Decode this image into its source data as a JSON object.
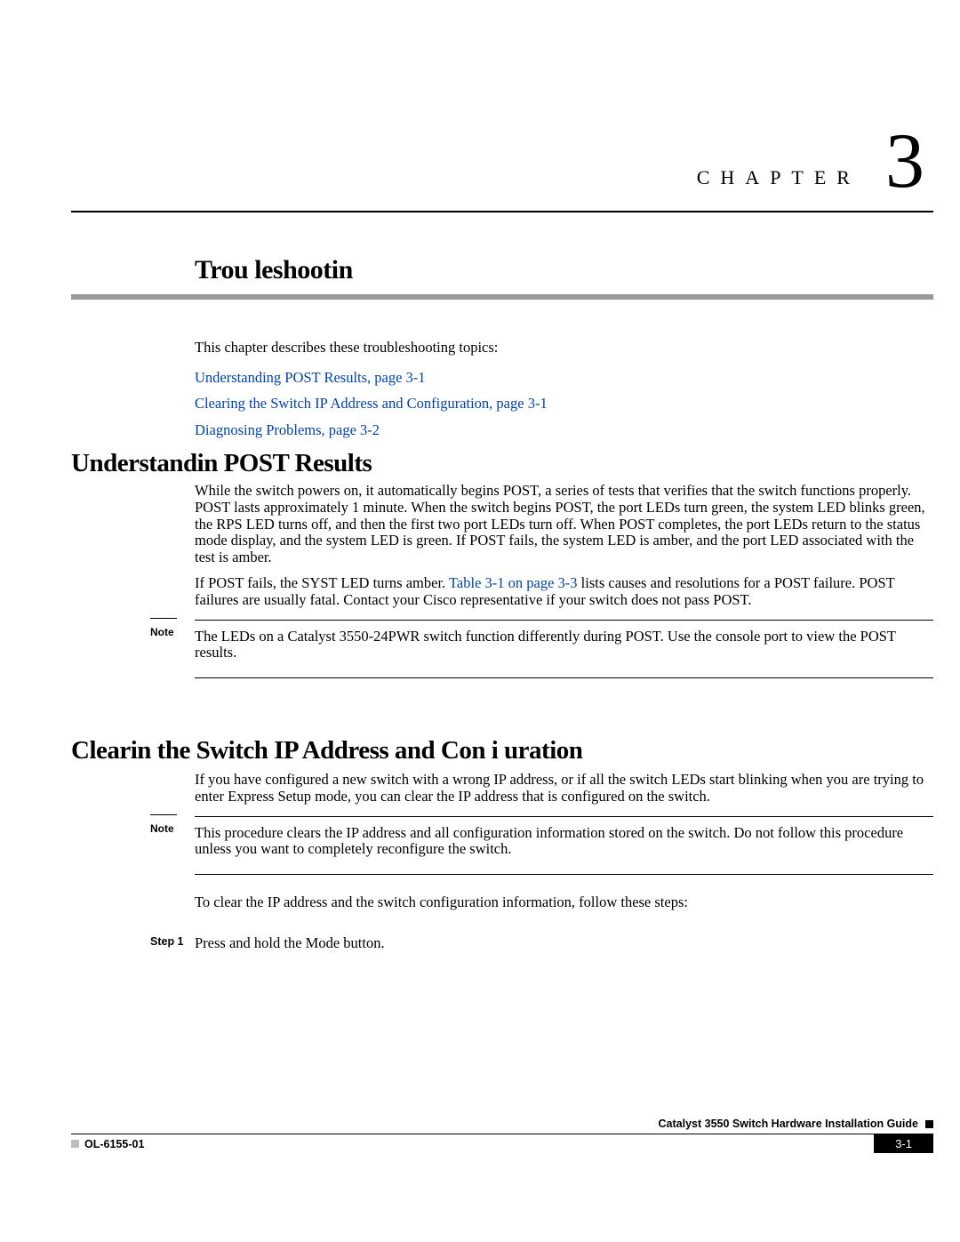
{
  "chapter": {
    "label": "CHAPTER",
    "number": "3",
    "title": "Trou  leshootin"
  },
  "intro": {
    "text": "This chapter describes these troubleshooting topics:",
    "links": [
      "Understanding POST Results, page 3-1",
      "Clearing the Switch IP Address and Configuration, page 3-1",
      "Diagnosing Problems, page 3-2"
    ]
  },
  "sections": {
    "post": {
      "heading": "Understandin  POST Results",
      "p1": "While the switch powers on, it automatically begins POST, a series of tests that verifies that the switch functions properly. POST lasts approximately 1 minute. When the switch begins POST, the port LEDs turn green, the system LED blinks green, the RPS LED turns off, and then the first two port LEDs turn off. When POST completes, the port LEDs return to the status mode display, and the system LED is green. If POST fails, the system LED is amber, and the port LED associated with the test is amber.",
      "p2_a": "If POST fails, the SYST LED turns amber. ",
      "p2_link": "Table 3-1 on page 3-3",
      "p2_b": " lists causes and resolutions for a POST failure. POST failures are usually fatal. Contact your Cisco representative if your switch does not pass POST.",
      "note_label": "Note",
      "note": "The LEDs on a Catalyst 3550-24PWR switch function differently during POST. Use the console port to view the POST results."
    },
    "clear": {
      "heading": "Clearin  the Switch IP Address and Con i uration",
      "p1": "If you have configured a new switch with a wrong IP address, or if all the switch LEDs start blinking when you are trying to enter Express Setup mode, you can clear the IP address that is configured on the switch.",
      "note_label": "Note",
      "note": "This procedure clears the IP address and all configuration information stored on the switch. Do not follow this procedure unless you want to completely reconfigure the switch.",
      "instr": "To clear the IP address and the switch configuration information, follow these steps:",
      "step1_label": "Step 1",
      "step1": "Press and hold the Mode button."
    }
  },
  "footer": {
    "guide_title": "Catalyst 3550 Switch Hardware Installation Guide",
    "doc_id": "OL-6155-01",
    "page": "3-1"
  }
}
